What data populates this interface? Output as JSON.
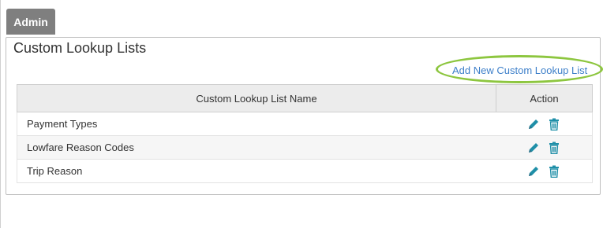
{
  "tab": {
    "label": "Admin"
  },
  "panel": {
    "title": "Custom Lookup Lists",
    "add_link": "Add New Custom Lookup List"
  },
  "table": {
    "headers": [
      "Custom Lookup List Name",
      "Action"
    ],
    "rows": [
      {
        "name": "Payment Types",
        "actions": [
          "edit-icon",
          "delete-icon"
        ]
      },
      {
        "name": "Lowfare Reason Codes",
        "actions": [
          "edit-icon",
          "delete-icon"
        ]
      },
      {
        "name": "Trip Reason",
        "actions": [
          "edit-icon",
          "delete-icon"
        ]
      }
    ]
  },
  "colors": {
    "tab_bg": "#7f7f7f",
    "link": "#3d7fc9",
    "highlight_ring": "#8dc63f",
    "icon": "#1f8fa8",
    "header_bg": "#ececec"
  }
}
